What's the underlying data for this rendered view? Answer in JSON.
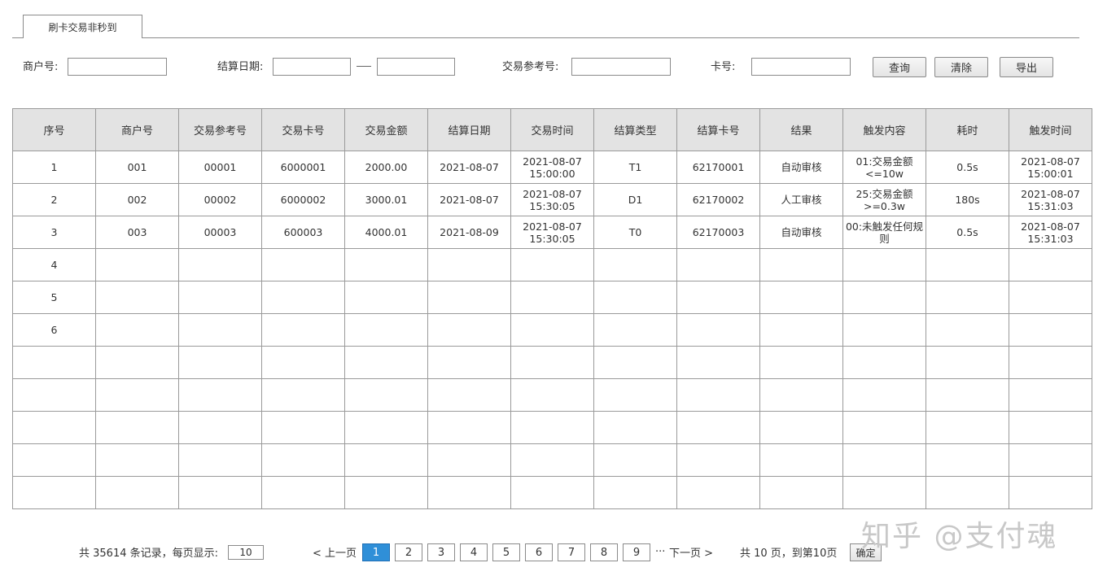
{
  "tab": {
    "label": "刷卡交易非秒到"
  },
  "filters": {
    "merchant_label": "商户号:",
    "merchant_value": "",
    "settle_date_label": "结算日期:",
    "settle_date_from": "",
    "settle_date_to": "",
    "ref_label": "交易参考号:",
    "ref_value": "",
    "card_label": "卡号:",
    "card_value": ""
  },
  "buttons": {
    "query": "查询",
    "clear": "清除",
    "export": "导出"
  },
  "table": {
    "columns": [
      "序号",
      "商户号",
      "交易参考号",
      "交易卡号",
      "交易金额",
      "结算日期",
      "交易时间",
      "结算类型",
      "结算卡号",
      "结果",
      "触发内容",
      "耗时",
      "触发时间"
    ],
    "rows": [
      [
        "1",
        "001",
        "00001",
        "6000001",
        "2000.00",
        "2021-08-07",
        "2021-08-07 15:00:00",
        "T1",
        "62170001",
        "自动审核",
        "01:交易金额<=10w",
        "0.5s",
        "2021-08-07 15:00:01"
      ],
      [
        "2",
        "002",
        "00002",
        "6000002",
        "3000.01",
        "2021-08-07",
        "2021-08-07 15:30:05",
        "D1",
        "62170002",
        "人工审核",
        "25:交易金额>=0.3w",
        "180s",
        "2021-08-07 15:31:03"
      ],
      [
        "3",
        "003",
        "00003",
        "600003",
        "4000.01",
        "2021-08-09",
        "2021-08-07 15:30:05",
        "T0",
        "62170003",
        "自动审核",
        "00:未触发任何规则",
        "0.5s",
        "2021-08-07 15:31:03"
      ],
      [
        "4",
        "",
        "",
        "",
        "",
        "",
        "",
        "",
        "",
        "",
        "",
        "",
        ""
      ],
      [
        "5",
        "",
        "",
        "",
        "",
        "",
        "",
        "",
        "",
        "",
        "",
        "",
        ""
      ],
      [
        "6",
        "",
        "",
        "",
        "",
        "",
        "",
        "",
        "",
        "",
        "",
        "",
        ""
      ],
      [
        "",
        "",
        "",
        "",
        "",
        "",
        "",
        "",
        "",
        "",
        "",
        "",
        ""
      ],
      [
        "",
        "",
        "",
        "",
        "",
        "",
        "",
        "",
        "",
        "",
        "",
        "",
        ""
      ],
      [
        "",
        "",
        "",
        "",
        "",
        "",
        "",
        "",
        "",
        "",
        "",
        "",
        ""
      ],
      [
        "",
        "",
        "",
        "",
        "",
        "",
        "",
        "",
        "",
        "",
        "",
        "",
        ""
      ],
      [
        "",
        "",
        "",
        "",
        "",
        "",
        "",
        "",
        "",
        "",
        "",
        "",
        ""
      ]
    ]
  },
  "pagination": {
    "total_text": "共 35614 条记录，每页显示:",
    "page_size": "10",
    "prev": "< 上一页",
    "pages": [
      "1",
      "2",
      "3",
      "4",
      "5",
      "6",
      "7",
      "8",
      "9"
    ],
    "current_page": "1",
    "ellipsis": "···",
    "next": "下一页 >",
    "total_pages_text": "共 10 页，到第10页",
    "confirm": "确定"
  },
  "watermark": "知乎 @支付魂",
  "colors": {
    "header_bg": "#e3e3e3",
    "active_page": "#2f8fd8",
    "border": "#9a9a9a"
  }
}
